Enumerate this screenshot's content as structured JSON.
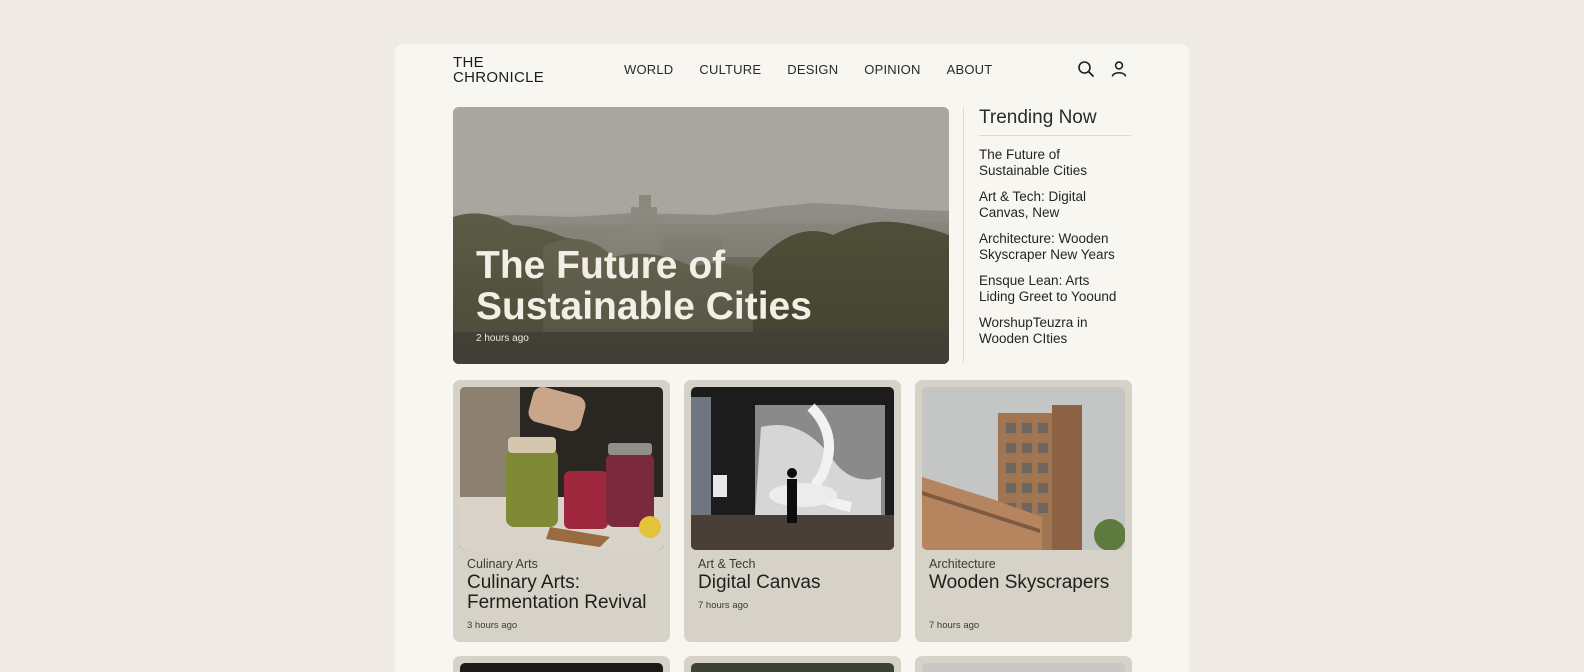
{
  "header": {
    "logo_line1": "THE",
    "logo_line2": "CHRONICLE",
    "nav": [
      "WORLD",
      "CULTURE",
      "DESIGN",
      "OPINION",
      "ABOUT"
    ]
  },
  "hero": {
    "title": "The Future of Sustainable Cities",
    "time": "2 hours ago"
  },
  "sidebar": {
    "title": "Trending Now",
    "items": [
      "The Future of Sustainable Cities",
      "Art & Tech: Digital Canvas, New",
      "Architecture: Wooden Skyscraper New Years",
      "Ensque Lean: Arts Liding Greet to Yoound",
      "WorshupTeuzra in Wooden CIties"
    ]
  },
  "cards": [
    {
      "category": "Culinary Arts",
      "title": "Culinary Arts: Fermentation Revival",
      "time": "3 hours ago"
    },
    {
      "category": "Art & Tech",
      "title": "Digital Canvas",
      "time": "7 hours ago"
    },
    {
      "category": "Architecture",
      "title": "Wooden Skyscrapers",
      "time": "7 hours ago"
    }
  ],
  "icons": {
    "search": "search-icon",
    "user": "user-icon"
  },
  "colors": {
    "background": "#efebe4",
    "page": "#f8f6f1",
    "card": "#d6d2c7"
  }
}
